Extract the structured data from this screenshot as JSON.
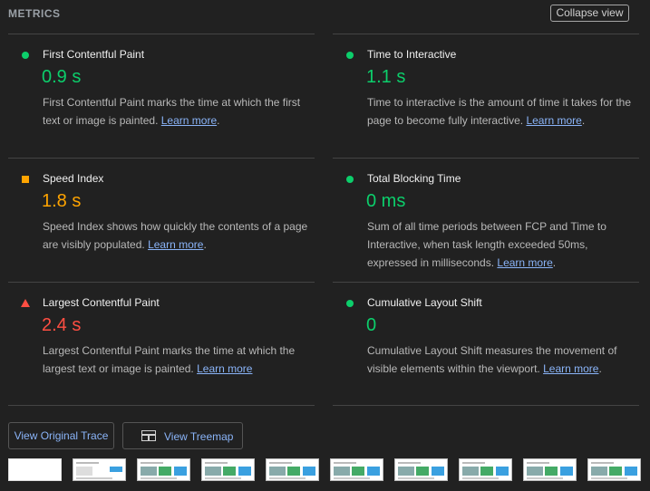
{
  "header": {
    "title": "METRICS",
    "collapse_label": "Collapse view"
  },
  "colors": {
    "pass": "#0cce6b",
    "average": "#ffa400",
    "fail": "#ff4e42",
    "link": "#8ab4f8"
  },
  "metrics": [
    {
      "name": "First Contentful Paint",
      "value": "0.9 s",
      "status": "pass",
      "indicator": "circle-icon",
      "desc": "First Contentful Paint marks the time at which the first text or image is painted.",
      "link": "Learn more",
      "after_link": "."
    },
    {
      "name": "Time to Interactive",
      "value": "1.1 s",
      "status": "pass",
      "indicator": "circle-icon",
      "desc": "Time to interactive is the amount of time it takes for the page to become fully interactive.",
      "link": "Learn more",
      "after_link": "."
    },
    {
      "name": "Speed Index",
      "value": "1.8 s",
      "status": "average",
      "indicator": "square-icon",
      "desc": "Speed Index shows how quickly the contents of a page are visibly populated.",
      "link": "Learn more",
      "after_link": "."
    },
    {
      "name": "Total Blocking Time",
      "value": "0 ms",
      "status": "pass",
      "indicator": "circle-icon",
      "desc": "Sum of all time periods between FCP and Time to Interactive, when task length exceeded 50ms, expressed in milliseconds.",
      "link": "Learn more",
      "after_link": "."
    },
    {
      "name": "Largest Contentful Paint",
      "value": "2.4 s",
      "status": "fail",
      "indicator": "triangle-icon",
      "desc": "Largest Contentful Paint marks the time at which the largest text or image is painted.",
      "link": "Learn more",
      "after_link": ""
    },
    {
      "name": "Cumulative Layout Shift",
      "value": "0",
      "status": "pass",
      "indicator": "circle-icon",
      "desc": "Cumulative Layout Shift measures the movement of visible elements within the viewport.",
      "link": "Learn more",
      "after_link": "."
    }
  ],
  "buttons": {
    "view_trace": "View Original Trace",
    "view_treemap": "View Treemap"
  },
  "thumbnails_count": 10
}
